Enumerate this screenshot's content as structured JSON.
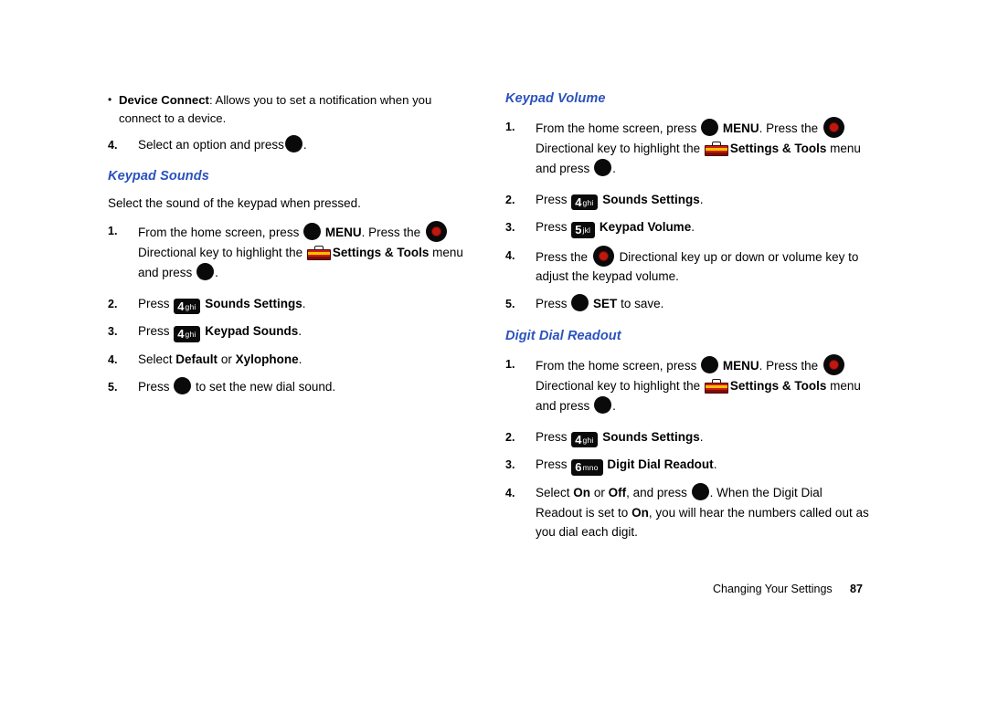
{
  "document": {
    "footer": {
      "chapter": "Changing Your Settings",
      "page_number": "87"
    }
  },
  "left_column": {
    "bullet": {
      "marker": "•",
      "term": "Device Connect",
      "text": ": Allows you to set a notification when you connect to a device."
    },
    "step4_top": {
      "num": "4.",
      "text_before": "Select an option and press",
      "text_after": "."
    },
    "section": {
      "heading": "Keypad Sounds",
      "intro": "Select the sound of the keypad when pressed.",
      "steps": [
        {
          "num": "1.",
          "p1": "From the home screen, press",
          "p2": "MENU",
          "p3": ". Press the",
          "p4": "Directional key to highlight the",
          "p5": "Settings & Tools",
          "p6": "menu and press",
          "p7": "."
        },
        {
          "num": "2.",
          "p1": "Press",
          "key_num": "4",
          "key_sub": "ghi",
          "p2": "Sounds Settings",
          "p3": "."
        },
        {
          "num": "3.",
          "p1": "Press",
          "key_num": "4",
          "key_sub": "ghi",
          "p2": "Keypad Sounds",
          "p3": "."
        },
        {
          "num": "4.",
          "p1": "Select",
          "opt1": "Default",
          "p2": "or",
          "opt2": "Xylophone",
          "p3": "."
        },
        {
          "num": "5.",
          "p1": "Press",
          "p2": "to set the new dial sound."
        }
      ]
    }
  },
  "right_column": {
    "keypad_volume": {
      "heading": "Keypad Volume",
      "steps": [
        {
          "num": "1.",
          "p1": "From the home screen, press",
          "p2": "MENU",
          "p3": ". Press the",
          "p4": "Directional key to highlight the",
          "p5": "Settings & Tools",
          "p6": "menu and press",
          "p7": "."
        },
        {
          "num": "2.",
          "p1": "Press",
          "key_num": "4",
          "key_sub": "ghi",
          "p2": "Sounds Settings",
          "p3": "."
        },
        {
          "num": "3.",
          "p1": "Press",
          "key_num": "5",
          "key_sub": "jkl",
          "p2": "Keypad Volume",
          "p3": "."
        },
        {
          "num": "4.",
          "p1": "Press the",
          "p2": "Directional key up or down or volume key to adjust the keypad volume."
        },
        {
          "num": "5.",
          "p1": "Press",
          "p2": "SET",
          "p3": "to save."
        }
      ]
    },
    "digit_dial_readout": {
      "heading": "Digit Dial Readout",
      "steps": [
        {
          "num": "1.",
          "p1": "From the home screen, press",
          "p2": "MENU",
          "p3": ". Press the",
          "p4": "Directional key to highlight the",
          "p5": "Settings & Tools",
          "p6": "menu and press",
          "p7": "."
        },
        {
          "num": "2.",
          "p1": "Press",
          "key_num": "4",
          "key_sub": "ghi",
          "p2": "Sounds Settings",
          "p3": "."
        },
        {
          "num": "3.",
          "p1": "Press",
          "key_num": "6",
          "key_sub": "mno",
          "p2": "Digit Dial Readout",
          "p3": "."
        },
        {
          "num": "4.",
          "p1": "Select",
          "opt1": "On",
          "p2": "or",
          "opt2": "Off",
          "p3": ", and press",
          "p4": ". When the Digit Dial Readout is set to",
          "opt3": "On",
          "p5": ", you will hear the numbers called out as you dial each digit."
        }
      ]
    }
  }
}
